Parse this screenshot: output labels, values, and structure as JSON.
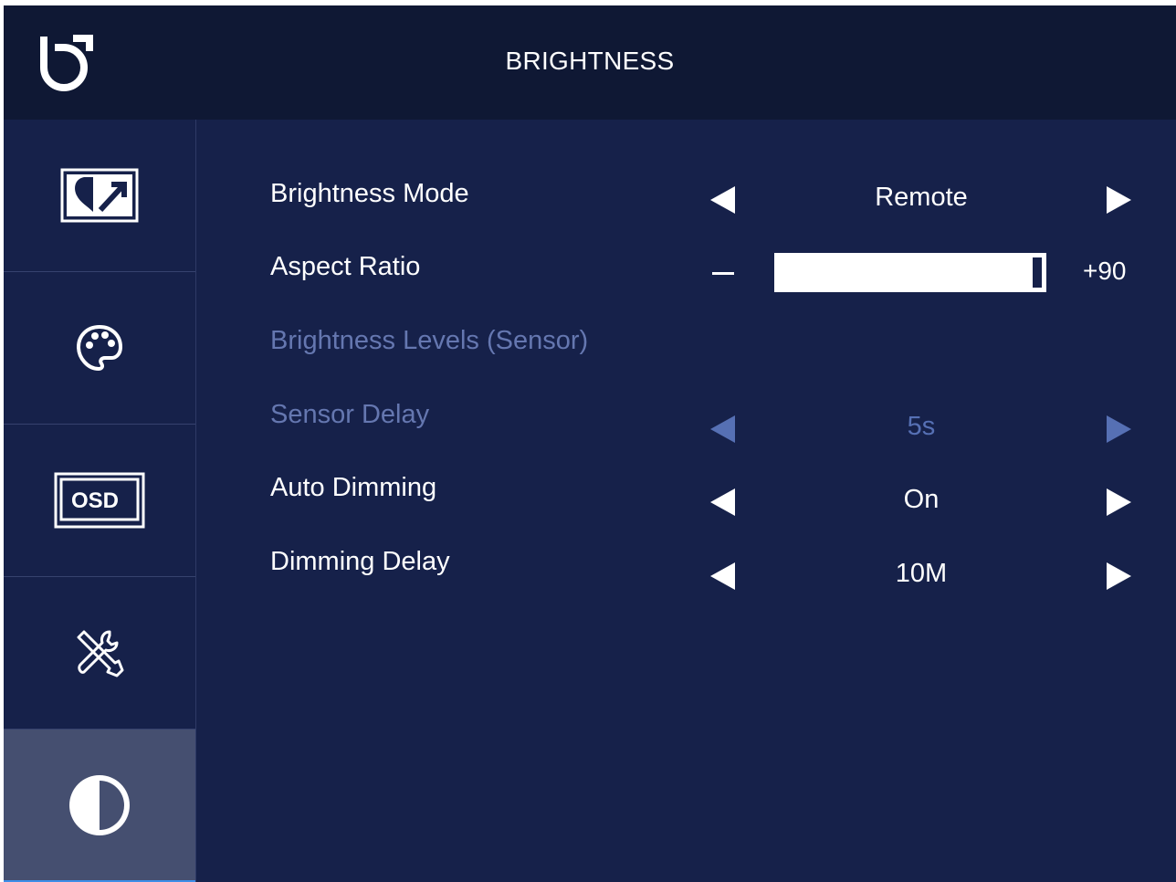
{
  "header": {
    "title": "BRIGHTNESS",
    "logo_icon": "brand-logo-icon"
  },
  "sidebar": {
    "items": [
      {
        "name": "picture",
        "icon": "picture-icon",
        "active": false
      },
      {
        "name": "color",
        "icon": "palette-icon",
        "active": false
      },
      {
        "name": "osd",
        "icon": "osd-icon",
        "icon_text": "OSD",
        "active": false
      },
      {
        "name": "setup",
        "icon": "tools-icon",
        "active": false
      },
      {
        "name": "brightness",
        "icon": "contrast-icon",
        "active": true
      }
    ]
  },
  "settings": {
    "brightness_mode": {
      "label": "Brightness Mode",
      "value": "Remote"
    },
    "aspect_ratio": {
      "label": "Aspect Ratio",
      "value": "+90",
      "level": 90,
      "level_max": 100
    },
    "brightness_levels": {
      "label": "Brightness Levels (Sensor)"
    },
    "sensor_delay": {
      "label": "Sensor Delay",
      "value": "5s"
    },
    "auto_dimming": {
      "label": "Auto Dimming",
      "value": "On"
    },
    "dimming_delay": {
      "label": "Dimming Delay",
      "value": "10M"
    }
  },
  "colors": {
    "background": "#16214a",
    "header": "#0f1834",
    "active_sidebar": "#454f70",
    "disabled_text": "#6577b0",
    "accent": "#3e8ee8"
  }
}
